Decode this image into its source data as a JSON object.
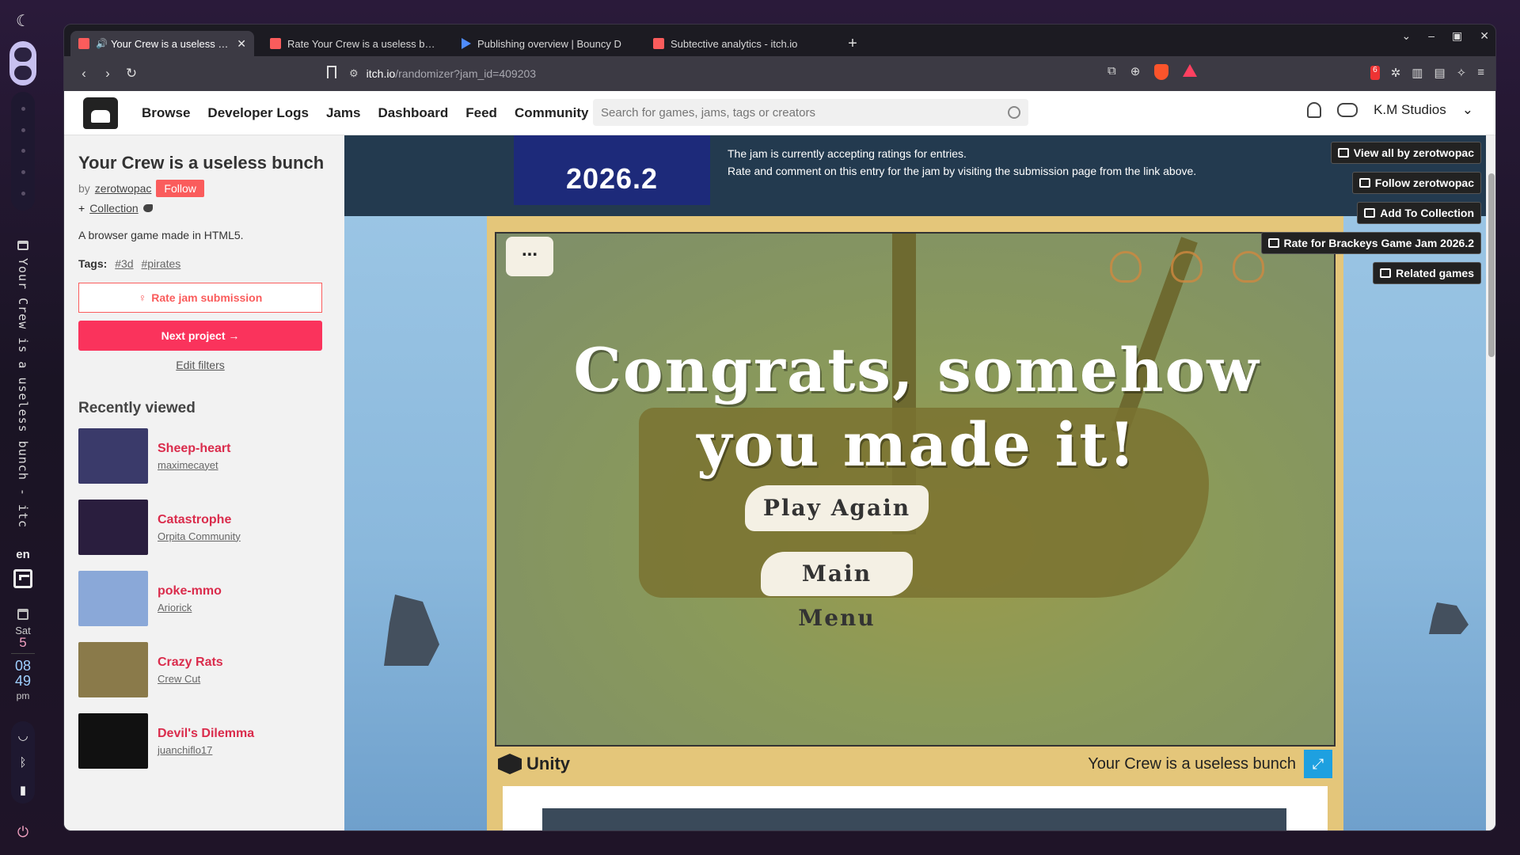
{
  "os": {
    "window_title": "Your Crew is a useless bunch - itch.i...",
    "language": "en",
    "day_name": "Sat",
    "day_num": "5",
    "time_h": "08",
    "time_m": "49",
    "time_ampm": "pm"
  },
  "tabs": [
    {
      "label": "Your Crew is a useless bunch",
      "audio": true,
      "active": true
    },
    {
      "label": "Rate Your Crew is a useless bunch"
    },
    {
      "label": "Publishing overview | Bouncy D"
    },
    {
      "label": "Subtective analytics - itch.io"
    }
  ],
  "url": {
    "host": "itch.io",
    "path": "/randomizer?jam_id=409203"
  },
  "header": {
    "nav": [
      "Browse",
      "Developer Logs",
      "Jams",
      "Dashboard",
      "Feed",
      "Community"
    ],
    "search_placeholder": "Search for games, jams, tags or creators",
    "user": "K.M Studios",
    "ext_badge": "6"
  },
  "game": {
    "title": "Your Crew is a useless bunch",
    "by_prefix": "by",
    "author": "zerotwopac",
    "follow_label": "Follow",
    "collection_label": "Collection",
    "description": "A browser game made in HTML5.",
    "tags_label": "Tags:",
    "tags": [
      "#3d",
      "#pirates"
    ],
    "rate_label": "Rate jam submission",
    "next_label": "Next project →",
    "edit_filters": "Edit filters"
  },
  "recently_viewed": {
    "heading": "Recently viewed",
    "items": [
      {
        "name": "Sheep-heart",
        "author": "maximecayet",
        "color": "#3a3a6a"
      },
      {
        "name": "Catastrophe",
        "author": "Orpita Community",
        "color": "#2a1e3e"
      },
      {
        "name": "poke-mmo",
        "author": "Ariorick",
        "color": "#8aa8d8"
      },
      {
        "name": "Crazy Rats",
        "author": "Crew Cut",
        "color": "#8a7a4a"
      },
      {
        "name": "Devil's Dilemma",
        "author": "juanchiflo17",
        "color": "#111111"
      }
    ]
  },
  "jam": {
    "year": "2026.2",
    "line1": "The jam is currently accepting ratings for entries.",
    "line2": "Rate and comment on this entry for the jam by visiting the submission page from the link above."
  },
  "side_buttons": [
    "View all by zerotwopac",
    "Follow zerotwopac",
    "Add To Collection",
    "Rate for Brackeys Game Jam 2026.2",
    "Related games"
  ],
  "game_screen": {
    "menu_dots": "...",
    "congrats_line1": "Congrats, somehow",
    "congrats_line2": "you made it!",
    "play_again": "Play Again",
    "main_menu": "Main Menu",
    "unity_label": "Unity",
    "game_name": "Your Crew is a useless bunch"
  }
}
